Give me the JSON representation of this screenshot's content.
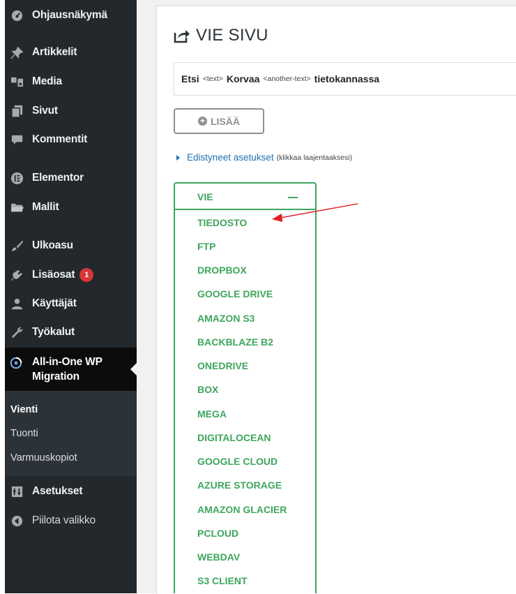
{
  "sidebar": {
    "items": [
      {
        "label": "Ohjausnäkymä",
        "icon": "dashboard-icon"
      },
      {
        "label": "Artikkelit",
        "icon": "pin-icon"
      },
      {
        "label": "Media",
        "icon": "media-icon"
      },
      {
        "label": "Sivut",
        "icon": "pages-icon"
      },
      {
        "label": "Kommentit",
        "icon": "comment-icon"
      },
      {
        "label": "Elementor",
        "icon": "elementor-icon"
      },
      {
        "label": "Mallit",
        "icon": "folder-icon"
      },
      {
        "label": "Ulkoasu",
        "icon": "brush-icon"
      },
      {
        "label": "Lisäosat",
        "icon": "plugin-icon",
        "badge": "1"
      },
      {
        "label": "Käyttäjät",
        "icon": "user-icon"
      },
      {
        "label": "Työkalut",
        "icon": "wrench-icon"
      }
    ],
    "active": {
      "label_line1": "All-in-One WP",
      "label_line2": "Migration",
      "icon": "migration-icon"
    },
    "submenu": [
      {
        "label": "Vienti",
        "current": true
      },
      {
        "label": "Tuonti",
        "current": false
      },
      {
        "label": "Varmuuskopiot",
        "current": false
      }
    ],
    "settings": {
      "label": "Asetukset",
      "icon": "settings-icon"
    },
    "collapse": {
      "label": "Piilota valikko",
      "icon": "collapse-icon"
    }
  },
  "page": {
    "title": "VIE SIVU",
    "replace": {
      "find_label": "Etsi",
      "find_placeholder": "<text>",
      "replace_label": "Korvaa",
      "replace_placeholder": "<another-text>",
      "suffix": "tietokannassa"
    },
    "add_button": "LISÄÄ",
    "advanced": {
      "link": "Edistyneet asetukset",
      "hint": "(klikkaa laajentaaksesi)"
    },
    "export": {
      "header": "VIE",
      "options": [
        "TIEDOSTO",
        "FTP",
        "DROPBOX",
        "GOOGLE DRIVE",
        "AMAZON S3",
        "BACKBLAZE B2",
        "ONEDRIVE",
        "BOX",
        "MEGA",
        "DIGITALOCEAN",
        "GOOGLE CLOUD",
        "AZURE STORAGE",
        "AMAZON GLACIER",
        "PCLOUD",
        "WEBDAV",
        "S3 CLIENT"
      ]
    }
  },
  "colors": {
    "sidebar_bg": "#23282d",
    "accent_green": "#3ea65d",
    "link_blue": "#2271b1",
    "arrow_red": "#e02020",
    "badge_red": "#d63638"
  }
}
